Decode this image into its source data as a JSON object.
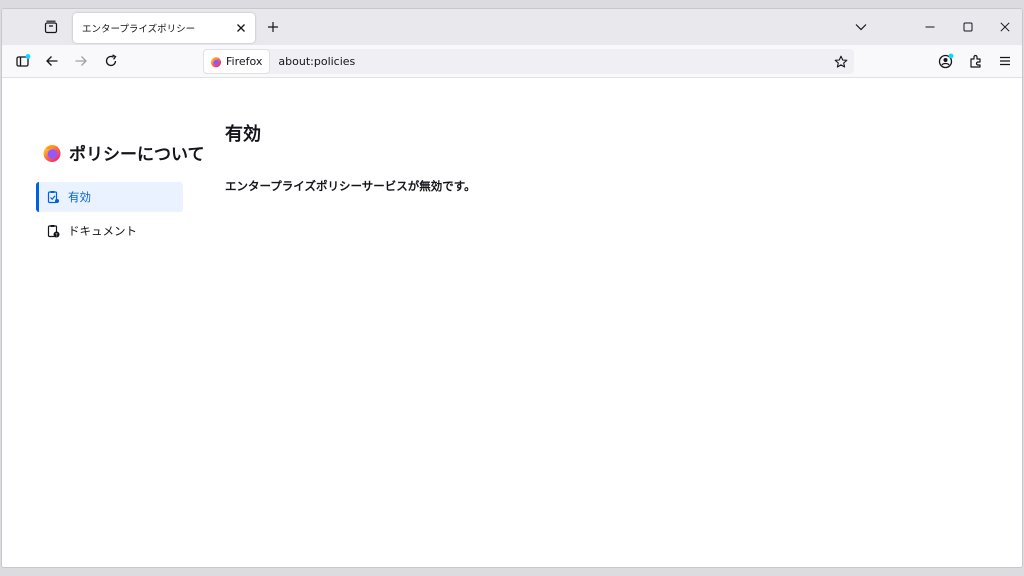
{
  "tab": {
    "title": "エンタープライズポリシー"
  },
  "urlbar": {
    "identity_label": "Firefox",
    "url": "about:policies"
  },
  "sidebar": {
    "title": "ポリシーについて",
    "items": [
      {
        "label": "有効",
        "selected": true,
        "icon": "policies-active-icon"
      },
      {
        "label": "ドキュメント",
        "selected": false,
        "icon": "documentation-icon"
      }
    ]
  },
  "main": {
    "heading": "有効",
    "message": "エンタープライズポリシーサービスが無効です。"
  },
  "colors": {
    "accent": "#0061e0",
    "badge": "#00ddff",
    "firefox_orange": "#ff7139",
    "firefox_purple": "#9059ff"
  }
}
